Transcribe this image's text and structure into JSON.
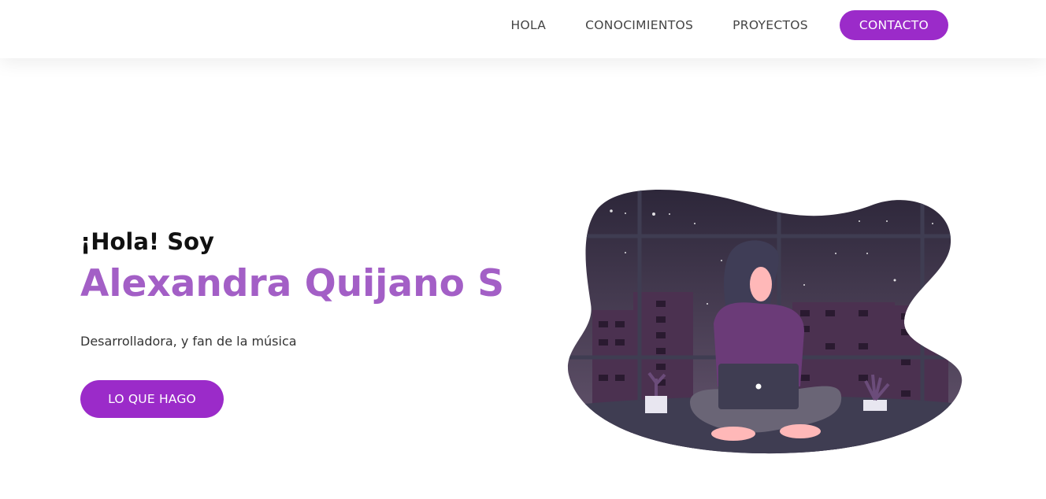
{
  "colors": {
    "accent": "#9b2bc9",
    "name_text": "#a35fc6",
    "sky_top": "#2c2639",
    "sky_bottom": "#675770",
    "building": "#4b3150",
    "floor": "#3f3d52"
  },
  "nav": {
    "items": [
      {
        "label": "HOLA"
      },
      {
        "label": "CONOCIMIENTOS"
      },
      {
        "label": "PROYECTOS"
      }
    ],
    "contact_label": "CONTACTO"
  },
  "hero": {
    "greeting": "¡Hola! Soy",
    "name": "Alexandra Quijano S",
    "tagline": "Desarrolladora, y fan de la música",
    "cta_label": "LO QUE HAGO",
    "illustration_icon": "woman-with-laptop-at-night-illustration"
  }
}
